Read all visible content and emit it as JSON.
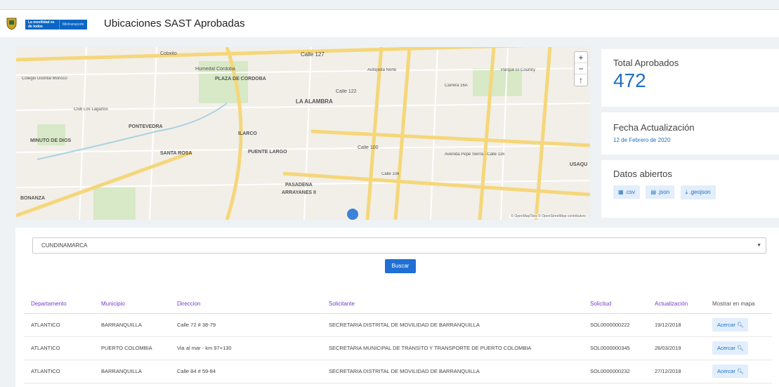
{
  "header": {
    "brand_line": "La movilidad es de todos",
    "brand_ministry": "Mintransporte",
    "title": "Ubicaciones SAST Aprobadas"
  },
  "map": {
    "zoom_in": "+",
    "zoom_out": "−",
    "north": "↑",
    "attribution": "© OpenMapTiles © OpenStreetMap contributors",
    "labels": [
      {
        "text": "Calle 127"
      },
      {
        "text": "Cobxito"
      },
      {
        "text": "Humedal Córdoba"
      },
      {
        "text": "PLAZA DE CÓRDOBA"
      },
      {
        "text": "LA ALAMBRA"
      },
      {
        "text": "Colegio Distrital Morisco"
      },
      {
        "text": "Club Los Lagartos"
      },
      {
        "text": "PONTEVEDRA"
      },
      {
        "text": "MINUTO DE DIOS"
      },
      {
        "text": "SANTA ROSA"
      },
      {
        "text": "ILARCO"
      },
      {
        "text": "PUENTE LARGO"
      },
      {
        "text": "PASADENA"
      },
      {
        "text": "ARRAYANES II"
      },
      {
        "text": "BONANZA"
      },
      {
        "text": "Parque El Country"
      },
      {
        "text": "Calle 122"
      },
      {
        "text": "Calle 100"
      },
      {
        "text": "USAQU"
      },
      {
        "text": "Avenida Pepe Sierra - Calle 116"
      },
      {
        "text": "Autopista Norte"
      },
      {
        "text": "Carrera 16A"
      },
      {
        "text": "Calle 106"
      }
    ]
  },
  "stats": {
    "total_label": "Total Aprobados",
    "total_value": "472",
    "updated_label": "Fecha Actualización",
    "updated_value": "12 de Febrero de 2020",
    "open_label": "Datos abiertos",
    "downloads": [
      ".csv",
      ".json",
      ".geojson"
    ]
  },
  "filter": {
    "department": "CUNDINAMARCA",
    "search_label": "Buscar"
  },
  "table": {
    "headers": [
      "Departamento",
      "Municipio",
      "Direccion",
      "Solicitante",
      "Solicitud",
      "Actualización",
      "Mostrar en mapa"
    ],
    "rows": [
      {
        "departamento": "ATLANTICO",
        "municipio": "BARRANQUILLA",
        "direccion": "Calle 72 # 38-79",
        "solicitante": "SECRETARIA DISTRITAL DE MOVILIDAD DE BARRANQUILLA",
        "solicitud": "SOL0000000222",
        "actualizacion": "19/12/2018",
        "accion": "Acercar"
      },
      {
        "departamento": "ATLANTICO",
        "municipio": "PUERTO COLOMBIA",
        "direccion": "Via al mar - km 97+130",
        "solicitante": "SECRETARIA MUNICIPAL DE TRANSITO Y TRANSPORTE DE PUERTO COLOMBIA",
        "solicitud": "SOL0000000345",
        "actualizacion": "26/03/2019",
        "accion": "Acercar"
      },
      {
        "departamento": "ATLANTICO",
        "municipio": "BARRANQUILLA",
        "direccion": "Calle 84 # 59-84",
        "solicitante": "SECRETARIA DISTRITAL DE MOVILIDAD DE BARRANQUILLA",
        "solicitud": "SOL0000000232",
        "actualizacion": "27/12/2018",
        "accion": "Acercar"
      }
    ]
  },
  "colors": {
    "accent": "#1f6fc5",
    "header_purple": "#7a3cc8",
    "brand_blue": "#0b66c3"
  }
}
